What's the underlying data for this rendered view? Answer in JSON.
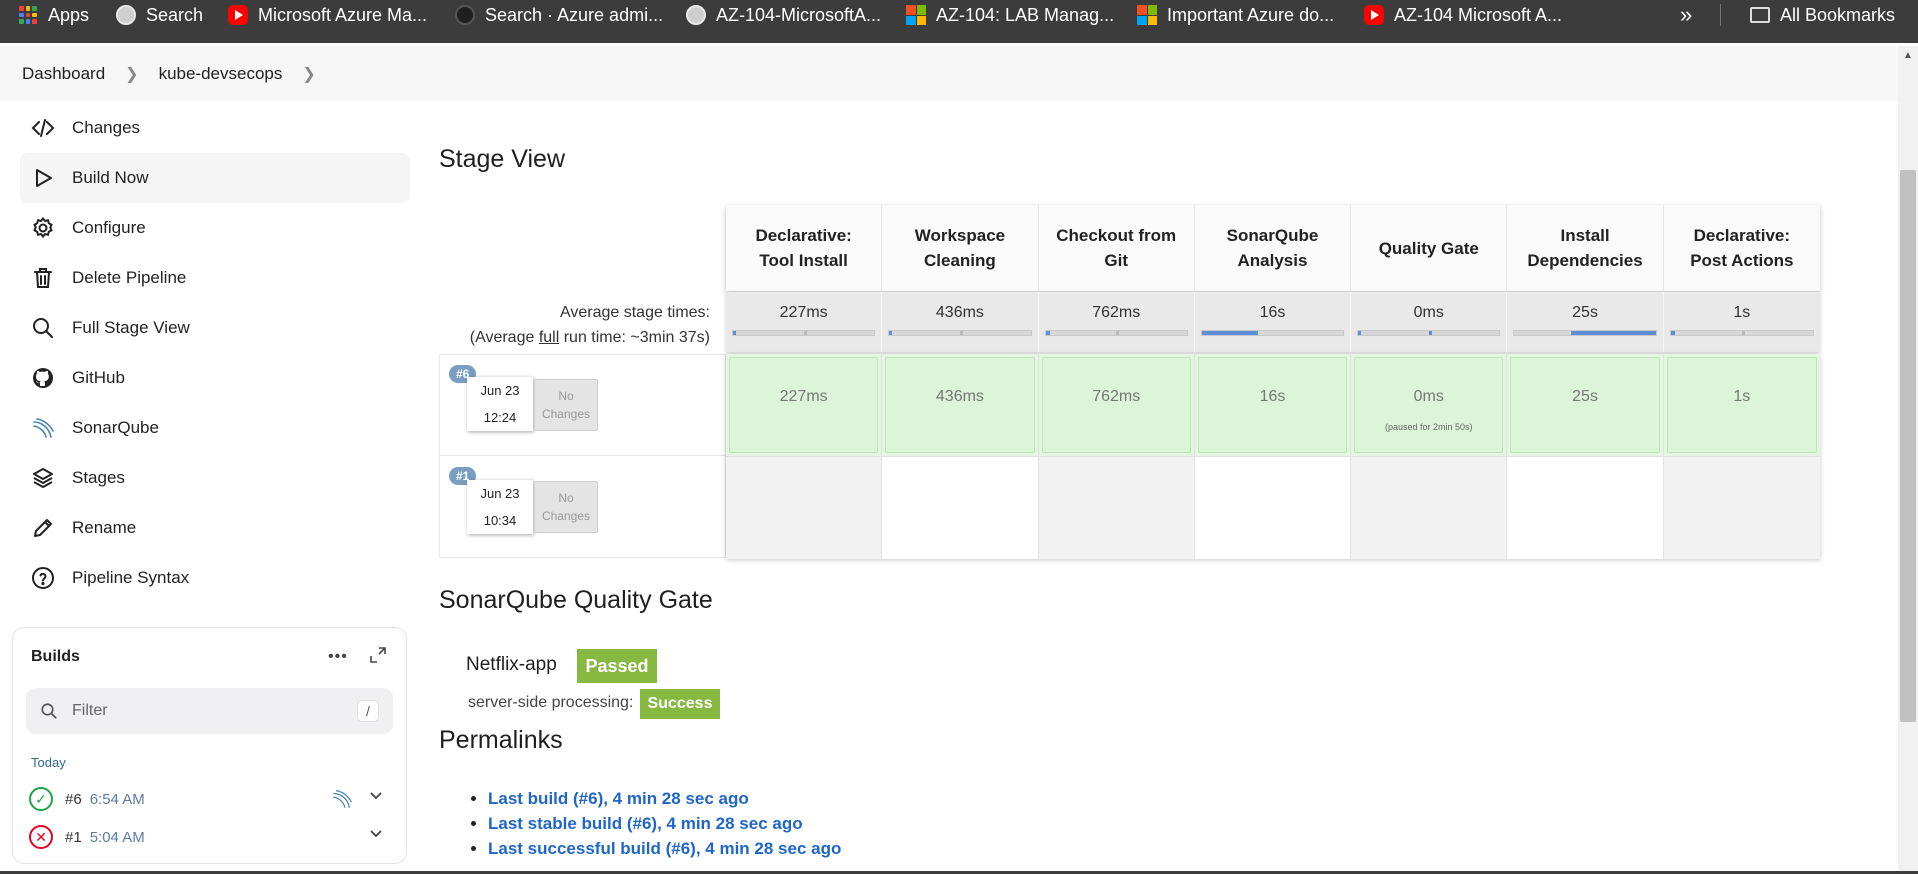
{
  "bookmarks": [
    {
      "label": "Apps",
      "icon": "apps-grid-icon"
    },
    {
      "label": "Search",
      "icon": "globe-icon"
    },
    {
      "label": "Microsoft Azure Ma...",
      "icon": "youtube-icon"
    },
    {
      "label": "Search · Azure admi...",
      "icon": "github-icon"
    },
    {
      "label": "AZ-104-MicrosoftA...",
      "icon": "globe-icon"
    },
    {
      "label": "AZ-104: LAB Manag...",
      "icon": "microsoft-icon"
    },
    {
      "label": "Important Azure do...",
      "icon": "microsoft-icon"
    },
    {
      "label": "AZ-104 Microsoft A...",
      "icon": "youtube-icon"
    }
  ],
  "bookmarks_more": "»",
  "all_bookmarks": "All Bookmarks",
  "breadcrumb": {
    "items": [
      "Dashboard",
      "kube-devsecops"
    ]
  },
  "sidebar": {
    "items": [
      {
        "label": "Changes",
        "icon": "code-icon"
      },
      {
        "label": "Build Now",
        "icon": "play-icon"
      },
      {
        "label": "Configure",
        "icon": "gear-icon"
      },
      {
        "label": "Delete Pipeline",
        "icon": "trash-icon"
      },
      {
        "label": "Full Stage View",
        "icon": "search-icon"
      },
      {
        "label": "GitHub",
        "icon": "github-icon"
      },
      {
        "label": "SonarQube",
        "icon": "sonarqube-icon"
      },
      {
        "label": "Stages",
        "icon": "layers-icon"
      },
      {
        "label": "Rename",
        "icon": "pencil-icon"
      },
      {
        "label": "Pipeline Syntax",
        "icon": "help-icon"
      }
    ]
  },
  "builds_panel": {
    "title": "Builds",
    "filter_placeholder": "Filter",
    "filter_shortcut": "/",
    "group_label": "Today",
    "builds": [
      {
        "number": "#6",
        "time": "6:54 AM",
        "status": "success"
      },
      {
        "number": "#1",
        "time": "5:04 AM",
        "status": "failed"
      }
    ]
  },
  "stage_view": {
    "heading": "Stage View",
    "stages": [
      {
        "name_line1": "Declarative:",
        "name_line2": "Tool Install",
        "avg": "227ms",
        "avg_fraction": 0.0
      },
      {
        "name_line1": "Workspace",
        "name_line2": "Cleaning",
        "avg": "436ms",
        "avg_fraction": 0.02
      },
      {
        "name_line1": "Checkout from",
        "name_line2": "Git",
        "avg": "762ms",
        "avg_fraction": 0.03
      },
      {
        "name_line1": "SonarQube",
        "name_line2": "Analysis",
        "avg": "16s",
        "avg_fraction": 0.4
      },
      {
        "name_line1": "Quality Gate",
        "name_line2": "",
        "avg": "0ms",
        "avg_fraction": 0.0
      },
      {
        "name_line1": "Install",
        "name_line2": "Dependencies",
        "avg": "25s",
        "avg_fraction": 0.6
      },
      {
        "name_line1": "Declarative:",
        "name_line2": "Post Actions",
        "avg": "1s",
        "avg_fraction": 0.03
      }
    ],
    "avg_label_line1": "Average stage times:",
    "avg_label_line2_prefix": "(Average ",
    "avg_label_line2_link": "full",
    "avg_label_line2_suffix": " run time: ~3min 37s)",
    "runs": [
      {
        "badge": "#6",
        "date": "Jun 23",
        "time": "12:24",
        "changes_line1": "No",
        "changes_line2": "Changes",
        "durations": [
          "227ms",
          "436ms",
          "762ms",
          "16s",
          "0ms",
          "25s",
          "1s"
        ],
        "notes": [
          "",
          "",
          "",
          "",
          "(paused for 2min 50s)",
          "",
          ""
        ]
      },
      {
        "badge": "#1",
        "date": "Jun 23",
        "time": "10:34",
        "changes_line1": "No",
        "changes_line2": "Changes",
        "durations": [
          "",
          "",
          "",
          "",
          "",
          "",
          ""
        ]
      }
    ]
  },
  "quality_gate": {
    "heading": "SonarQube Quality Gate",
    "project": "Netflix-app",
    "status": "Passed",
    "processing_label": "server-side processing:",
    "processing_status": "Success",
    "color_passed": "#87b840"
  },
  "permalinks": {
    "heading": "Permalinks",
    "links": [
      "Last build (#6), 4 min 28 sec ago",
      "Last stable build (#6), 4 min 28 sec ago",
      "Last successful build (#6), 4 min 28 sec ago"
    ]
  }
}
